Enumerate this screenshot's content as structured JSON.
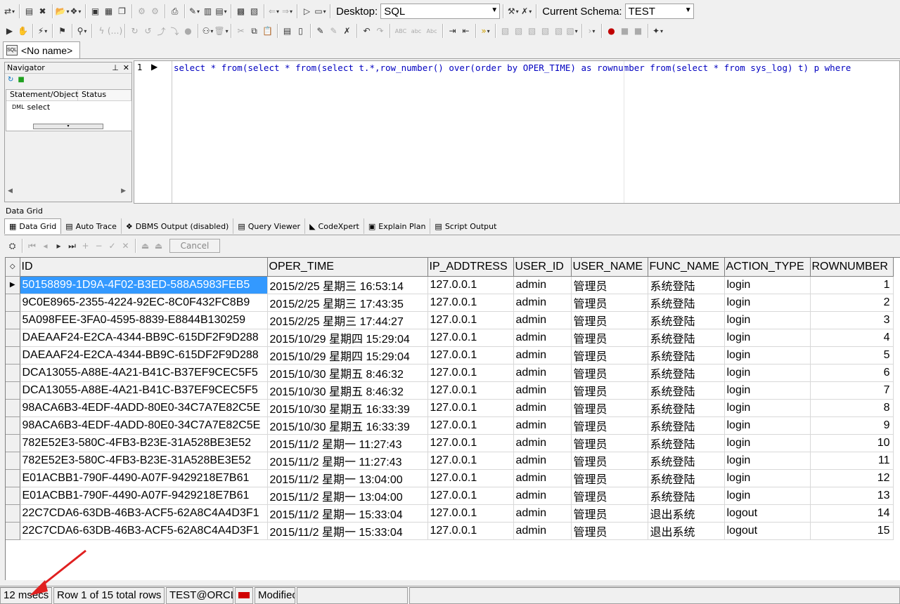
{
  "toolbar1": {
    "desktop_label": "Desktop:",
    "desktop_value": "SQL",
    "schema_label": "Current Schema:",
    "schema_value": "TEST"
  },
  "document_tab": {
    "icon": "sql-icon",
    "label": "<No name>"
  },
  "navigator": {
    "title": "Navigator",
    "columns": [
      "Statement/Object",
      "Status"
    ],
    "items": [
      {
        "type": "DML",
        "label": "select"
      }
    ]
  },
  "editor": {
    "line_number": "1",
    "sql": "select * from(select * from(select t.*,row_number() over(order by OPER_TIME) as rownumber from(select * from sys_log) t) p where"
  },
  "data_grid_label": "Data Grid",
  "bottom_tabs": [
    "Data Grid",
    "Auto Trace",
    "DBMS Output (disabled)",
    "Query Viewer",
    "CodeXpert",
    "Explain Plan",
    "Script Output"
  ],
  "grid_toolbar": {
    "cancel_label": "Cancel"
  },
  "grid": {
    "columns": [
      "ID",
      "OPER_TIME",
      "IP_ADDTRESS",
      "USER_ID",
      "USER_NAME",
      "FUNC_NAME",
      "ACTION_TYPE",
      "ROWNUMBER"
    ],
    "rows": [
      [
        "50158899-1D9A-4F02-B3ED-588A5983FEB5",
        "2015/2/25 星期三 16:53:14",
        "127.0.0.1",
        "admin",
        "管理员",
        "系统登陆",
        "login",
        "1"
      ],
      [
        "9C0E8965-2355-4224-92EC-8C0F432FC8B9",
        "2015/2/25 星期三 17:43:35",
        "127.0.0.1",
        "admin",
        "管理员",
        "系统登陆",
        "login",
        "2"
      ],
      [
        "5A098FEE-3FA0-4595-8839-E8844B130259",
        "2015/2/25 星期三 17:44:27",
        "127.0.0.1",
        "admin",
        "管理员",
        "系统登陆",
        "login",
        "3"
      ],
      [
        "DAEAAF24-E2CA-4344-BB9C-615DF2F9D288",
        "2015/10/29 星期四 15:29:04",
        "127.0.0.1",
        "admin",
        "管理员",
        "系统登陆",
        "login",
        "4"
      ],
      [
        "DAEAAF24-E2CA-4344-BB9C-615DF2F9D288",
        "2015/10/29 星期四 15:29:04",
        "127.0.0.1",
        "admin",
        "管理员",
        "系统登陆",
        "login",
        "5"
      ],
      [
        "DCA13055-A88E-4A21-B41C-B37EF9CEC5F5",
        "2015/10/30 星期五 8:46:32",
        "127.0.0.1",
        "admin",
        "管理员",
        "系统登陆",
        "login",
        "6"
      ],
      [
        "DCA13055-A88E-4A21-B41C-B37EF9CEC5F5",
        "2015/10/30 星期五 8:46:32",
        "127.0.0.1",
        "admin",
        "管理员",
        "系统登陆",
        "login",
        "7"
      ],
      [
        "98ACA6B3-4EDF-4ADD-80E0-34C7A7E82C5E",
        "2015/10/30 星期五 16:33:39",
        "127.0.0.1",
        "admin",
        "管理员",
        "系统登陆",
        "login",
        "8"
      ],
      [
        "98ACA6B3-4EDF-4ADD-80E0-34C7A7E82C5E",
        "2015/10/30 星期五 16:33:39",
        "127.0.0.1",
        "admin",
        "管理员",
        "系统登陆",
        "login",
        "9"
      ],
      [
        "782E52E3-580C-4FB3-B23E-31A528BE3E52",
        "2015/11/2 星期一 11:27:43",
        "127.0.0.1",
        "admin",
        "管理员",
        "系统登陆",
        "login",
        "10"
      ],
      [
        "782E52E3-580C-4FB3-B23E-31A528BE3E52",
        "2015/11/2 星期一 11:27:43",
        "127.0.0.1",
        "admin",
        "管理员",
        "系统登陆",
        "login",
        "11"
      ],
      [
        "E01ACBB1-790F-4490-A07F-9429218E7B61",
        "2015/11/2 星期一 13:04:00",
        "127.0.0.1",
        "admin",
        "管理员",
        "系统登陆",
        "login",
        "12"
      ],
      [
        "E01ACBB1-790F-4490-A07F-9429218E7B61",
        "2015/11/2 星期一 13:04:00",
        "127.0.0.1",
        "admin",
        "管理员",
        "系统登陆",
        "login",
        "13"
      ],
      [
        "22C7CDA6-63DB-46B3-ACF5-62A8C4A4D3F1",
        "2015/11/2 星期一 15:33:04",
        "127.0.0.1",
        "admin",
        "管理员",
        "退出系统",
        "logout",
        "14"
      ],
      [
        "22C7CDA6-63DB-46B3-ACF5-62A8C4A4D3F1",
        "2015/11/2 星期一 15:33:04",
        "127.0.0.1",
        "admin",
        "管理员",
        "退出系统",
        "logout",
        "15"
      ]
    ]
  },
  "status": {
    "elapsed": "12 msecs",
    "rows": "Row 1 of 15 total rows",
    "connection": "TEST@ORCL",
    "modified": "Modifiec"
  },
  "colors": {
    "selection": "#3399ff",
    "sql_text": "#0000c0",
    "annotation_arrow": "#e02020"
  }
}
